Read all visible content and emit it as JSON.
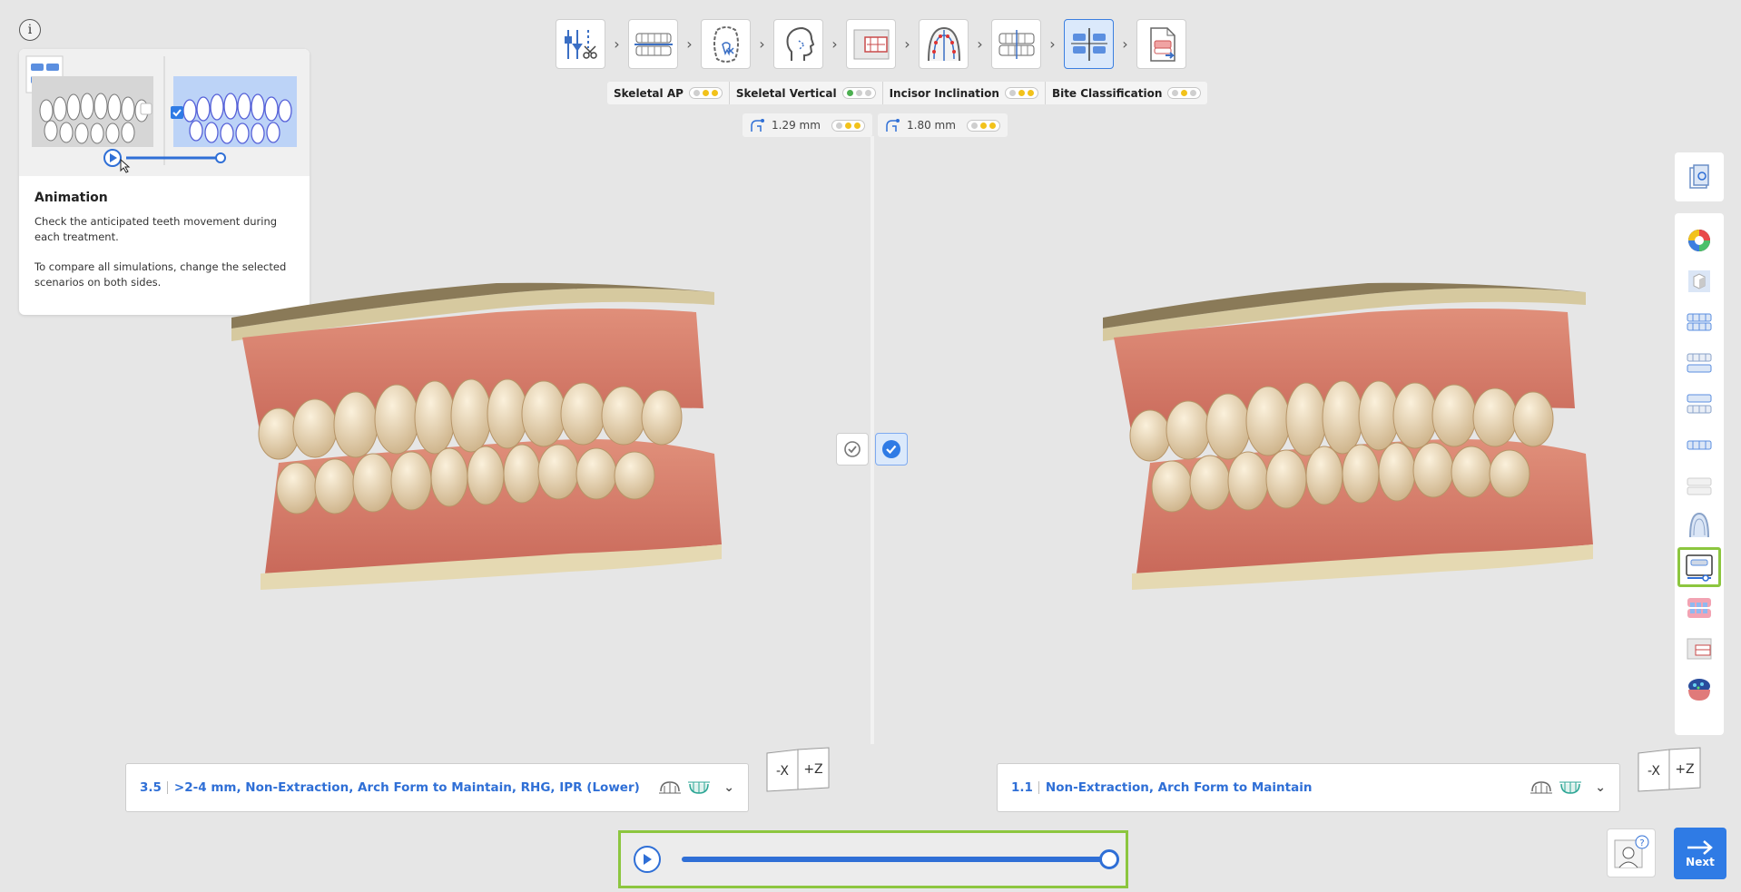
{
  "colors": {
    "accent": "#2f7be5",
    "highlight": "#8cc63f",
    "dot_green": "#4caf50",
    "dot_yellow": "#f2c21b",
    "dot_gray": "#cfcfcf"
  },
  "info": {
    "icon": "info-icon",
    "glyph": "i"
  },
  "help_card": {
    "title": "Animation",
    "paragraphs": [
      "Check the anticipated teeth movement during each treatment.",
      "To compare all simulations, change the selected scenarios on both sides."
    ],
    "preview_slider_progress": 1.0
  },
  "workflow_steps": [
    {
      "icon": "setup-tools-icon",
      "active": false
    },
    {
      "icon": "align-arches-icon",
      "active": false
    },
    {
      "icon": "tooth-segmentation-icon",
      "active": false
    },
    {
      "icon": "face-profile-icon",
      "active": false
    },
    {
      "icon": "cephalometric-icon",
      "active": false
    },
    {
      "icon": "arch-form-icon",
      "active": false
    },
    {
      "icon": "occlusion-icon",
      "active": false
    },
    {
      "icon": "compare-simulations-icon",
      "active": true
    },
    {
      "icon": "export-report-icon",
      "active": false
    }
  ],
  "analysis": [
    {
      "label": "Skeletal AP",
      "dots": [
        "#cfcfcf",
        "#f2c21b",
        "#f2c21b"
      ]
    },
    {
      "label": "Skeletal Vertical",
      "dots": [
        "#4caf50",
        "#cfcfcf",
        "#cfcfcf"
      ]
    },
    {
      "label": "Incisor Inclination",
      "dots": [
        "#cfcfcf",
        "#f2c21b",
        "#f2c21b"
      ]
    },
    {
      "label": "Bite Classification",
      "dots": [
        "#cfcfcf",
        "#f2c21b",
        "#cfcfcf"
      ]
    }
  ],
  "measurements": {
    "left": {
      "value": "1.29 mm",
      "dots": [
        "#cfcfcf",
        "#f2c21b",
        "#f2c21b"
      ]
    },
    "right": {
      "value": "1.80 mm",
      "dots": [
        "#cfcfcf",
        "#f2c21b",
        "#f2c21b"
      ]
    }
  },
  "select_toggles": {
    "left_selected": false,
    "right_selected": true
  },
  "scenarios": {
    "left": {
      "number": "3.5",
      "label": ">2-4 mm, Non-Extraction, Arch Form to Maintain, RHG, IPR (Lower)"
    },
    "right": {
      "number": "1.1",
      "label": "Non-Extraction, Arch Form to Maintain"
    }
  },
  "axis_cube": {
    "left_face": "-X",
    "right_face": "+Z"
  },
  "right_toolbar": {
    "top": "screenshot-icon",
    "items": [
      {
        "icon": "color-wheel-icon",
        "highlight": false
      },
      {
        "icon": "cube-view-icon",
        "highlight": false
      },
      {
        "icon": "upper-arch-icon",
        "highlight": false
      },
      {
        "icon": "both-arches-icon",
        "highlight": false
      },
      {
        "icon": "bite-view-icon",
        "highlight": false
      },
      {
        "icon": "lower-arch-icon",
        "highlight": false
      },
      {
        "icon": "ghost-arch-icon",
        "highlight": false
      },
      {
        "icon": "occlusal-view-icon",
        "highlight": false
      },
      {
        "icon": "animation-panel-icon",
        "highlight": true
      },
      {
        "icon": "gingiva-view-icon",
        "highlight": false
      },
      {
        "icon": "ceph-overlay-icon",
        "highlight": false
      },
      {
        "icon": "occlusion-map-icon",
        "highlight": false
      }
    ]
  },
  "timeline": {
    "progress": 1.0
  },
  "next_button": {
    "label": "Next"
  }
}
